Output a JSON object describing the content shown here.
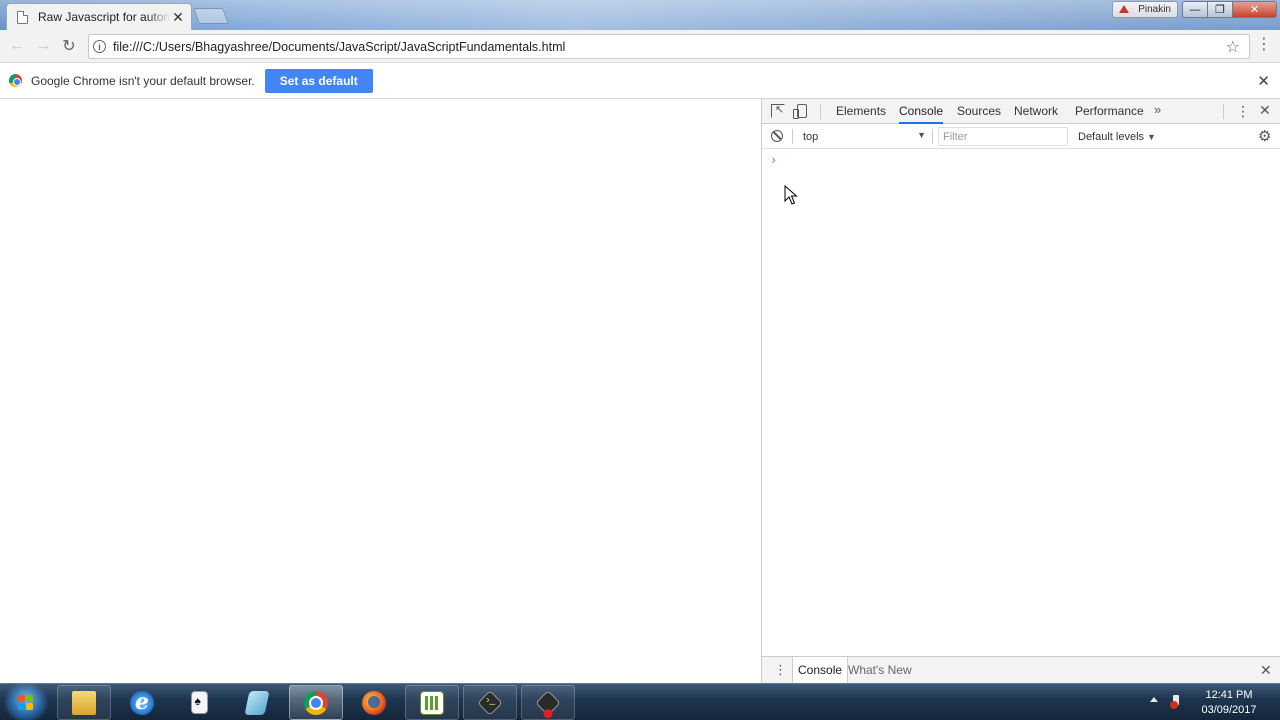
{
  "browser": {
    "tab": {
      "title": "Raw Javascript for automation",
      "close_glyph": "✕"
    },
    "profile_name": "Pinakin",
    "window_controls": {
      "minimize": "—",
      "maximize": "❐",
      "close": "✕"
    },
    "nav": {
      "back": "←",
      "forward": "→",
      "reload": "↻"
    },
    "url": "file:///C:/Users/Bhagyashree/Documents/JavaScript/JavaScriptFundamentals.html",
    "bookmark_glyph": "☆",
    "menu_glyph": "⋮"
  },
  "infobar": {
    "message": "Google Chrome isn't your default browser.",
    "button_label": "Set as default",
    "close_glyph": "✕"
  },
  "devtools": {
    "tabs": [
      {
        "label": "Elements",
        "active": false
      },
      {
        "label": "Console",
        "active": true
      },
      {
        "label": "Sources",
        "active": false
      },
      {
        "label": "Network",
        "active": false
      },
      {
        "label": "Performance",
        "active": false
      }
    ],
    "more_glyph": "»",
    "kebab_glyph": "⋮",
    "close_glyph": "✕",
    "console_bar": {
      "context": "top",
      "context_arrow": "▼",
      "filter_placeholder": "Filter",
      "levels": "Default levels",
      "levels_arrow": "▼",
      "gear_glyph": "⚙"
    },
    "prompt_glyph": "›",
    "drawer": {
      "kebab_glyph": "⋮",
      "tabs": [
        "Console",
        "What's New"
      ],
      "close_glyph": "✕"
    }
  },
  "taskbar": {
    "apps": [
      "windows-explorer",
      "internet-explorer",
      "solitaire",
      "notepad",
      "chrome",
      "firefox",
      "chart-app",
      "terminal",
      "recorder"
    ],
    "active_app": "chrome",
    "clock": {
      "time": "12:41 PM",
      "date": "03/09/2017"
    }
  },
  "colors": {
    "devtools_active_tab": "#1a73e8",
    "set_default_button": "#4285f4",
    "console_prompt": "#367cf1"
  }
}
